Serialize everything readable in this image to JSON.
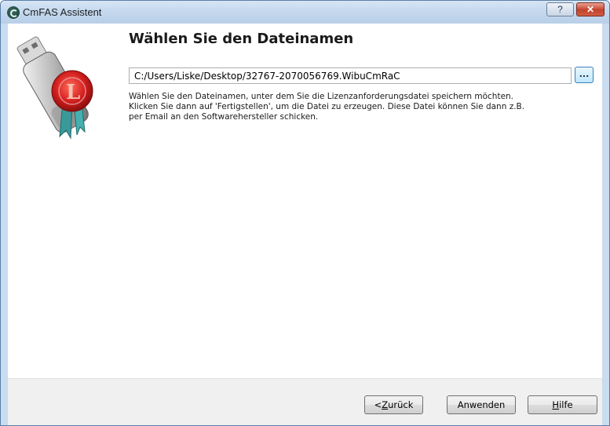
{
  "window": {
    "title": "CmFAS Assistent",
    "help_button": "?",
    "close_button": "✕"
  },
  "main": {
    "heading": "Wählen Sie den Dateinamen",
    "file_path": "C:/Users/Liske/Desktop/32767-2070056769.WibuCmRaC",
    "browse_label": "...",
    "description_lines": [
      "Wählen Sie den Dateinamen, unter dem Sie die Lizenzanforderungsdatei speichern möchten.",
      "Klicken Sie dann auf 'Fertigstellen', um die Datei zu erzeugen. Diese Datei können Sie dann z.B.",
      "per Email an den Softwarehersteller schicken."
    ]
  },
  "footer": {
    "back_prefix": "< ",
    "back_mnemonic": "Z",
    "back_rest": "urück",
    "apply_label": "Anwenden",
    "help_mnemonic": "H",
    "help_rest": "ilfe"
  }
}
